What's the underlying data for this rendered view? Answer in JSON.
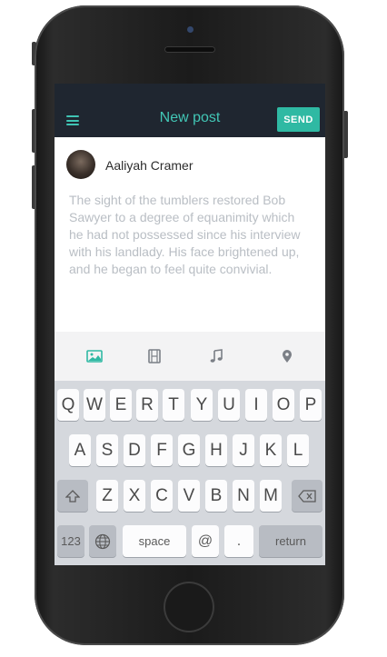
{
  "header": {
    "title": "New post",
    "send_label": "SEND"
  },
  "post": {
    "author": "Aaliyah Cramer",
    "text": "The sight of the tumblers restored Bob Sawyer to a degree of equanimity which he had not possessed since his interview with his landlady. His face brightened up, and he began to feel quite convivial."
  },
  "attachments": [
    "photo-icon",
    "film-icon",
    "music-icon",
    "location-pin-icon"
  ],
  "colors": {
    "accent": "#42c7b6",
    "send_bg": "#2fb9a3",
    "topbar_bg": "#1f2630"
  },
  "keyboard": {
    "row1": [
      "Q",
      "W",
      "E",
      "R",
      "T",
      "Y",
      "U",
      "I",
      "O",
      "P"
    ],
    "row2": [
      "A",
      "S",
      "D",
      "F",
      "G",
      "H",
      "J",
      "K",
      "L"
    ],
    "row3": [
      "Z",
      "X",
      "C",
      "V",
      "B",
      "N",
      "M"
    ],
    "numbers_label": "123",
    "space_label": "space",
    "at_label": "@",
    "dot_label": ".",
    "return_label": "return"
  }
}
